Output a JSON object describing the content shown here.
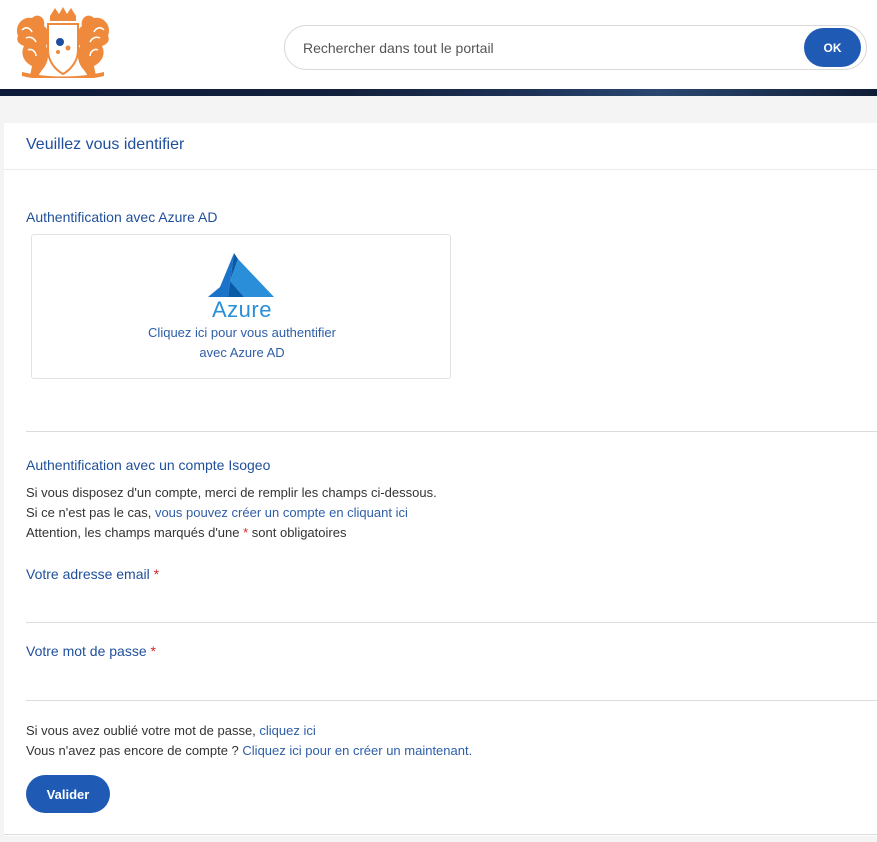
{
  "header": {
    "search_placeholder": "Rechercher dans tout le portail",
    "search_button": "OK"
  },
  "login": {
    "title": "Veuillez vous identifier",
    "azure": {
      "heading": "Authentification avec Azure AD",
      "logo_text": "Azure",
      "link_line1": "Cliquez ici pour vous authentifier",
      "link_line2": "avec Azure AD"
    },
    "isogeo": {
      "heading": "Authentification avec un compte Isogeo",
      "intro": "Si vous disposez d'un compte, merci de remplir les champs ci-dessous.",
      "no_account_prefix": "Si ce n'est pas le cas, ",
      "no_account_link": "vous pouvez créer un compte en cliquant ici",
      "required_note_prefix": "Attention, les champs marqués d'une ",
      "required_star": "*",
      "required_note_suffix": " sont obligatoires",
      "email_label": "Votre adresse email",
      "password_label": "Votre mot de passe",
      "forgot_prefix": "Si vous avez oublié votre mot de passe, ",
      "forgot_link": "cliquez ici",
      "create_prefix": "Vous n'avez pas encore de compte ? ",
      "create_link": "Cliquez ici pour en créer un maintenant.",
      "submit": "Valider"
    }
  },
  "colors": {
    "primary": "#1f5bb5",
    "heading": "#1f4f9c",
    "link": "#2e5ea8",
    "required": "#d12a2a",
    "logo_orange": "#ef8a3c",
    "azure_blue": "#2a8ed8"
  },
  "icons": {
    "logo": "coat-of-arms-logo",
    "azure": "azure-logo-icon"
  }
}
